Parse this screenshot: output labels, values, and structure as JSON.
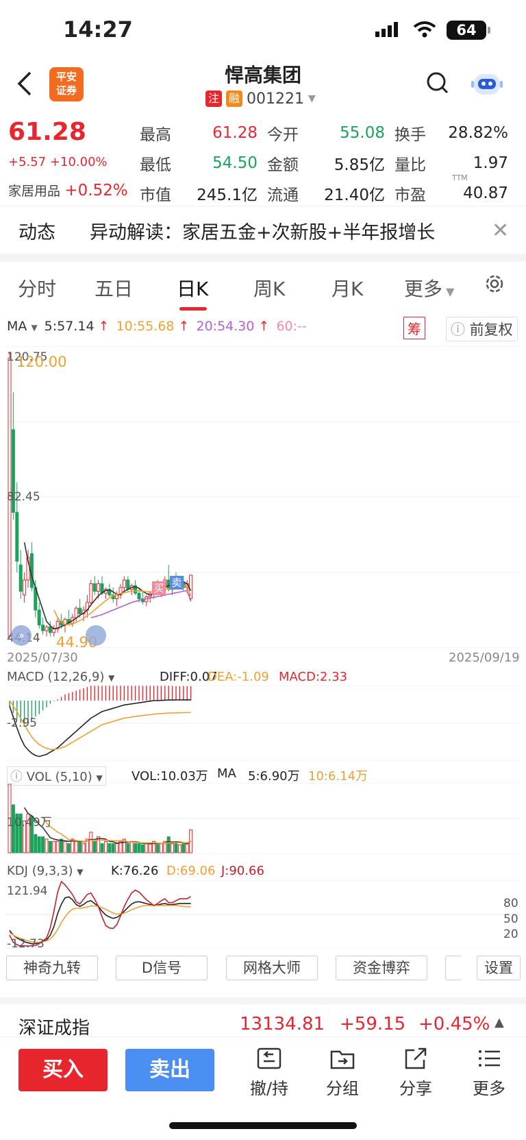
{
  "status": {
    "time": "14:27",
    "battery": "64"
  },
  "header": {
    "title": "悍高集团",
    "tag1": "注",
    "tag2": "融",
    "code": "001221",
    "logo_line1": "平安",
    "logo_line2": "证券"
  },
  "quote": {
    "price": "61.28",
    "change": "+5.57",
    "change_pct": "+10.00%",
    "sector": "家居用品",
    "sector_pct": "+0.52%",
    "rows": [
      [
        {
          "label": "最高",
          "value": "61.28",
          "color": "red"
        },
        {
          "label": "今开",
          "value": "55.08",
          "color": "green"
        },
        {
          "label": "换手",
          "value": "28.82%",
          "color": "black"
        }
      ],
      [
        {
          "label": "最低",
          "value": "54.50",
          "color": "green"
        },
        {
          "label": "金额",
          "value": "5.85亿",
          "color": "black"
        },
        {
          "label": "量比",
          "value": "1.97",
          "color": "black"
        }
      ],
      [
        {
          "label": "市值",
          "value": "245.1亿",
          "color": "black"
        },
        {
          "label": "流通",
          "value": "21.40亿",
          "color": "black"
        },
        {
          "label": "市盈",
          "value": "40.87",
          "color": "black"
        }
      ]
    ],
    "ttm": "TTM"
  },
  "news": {
    "tag": "动态",
    "text": "异动解读：家居五金+次新股+半年报增长"
  },
  "tabs": [
    "分时",
    "五日",
    "日K",
    "周K",
    "月K",
    "更多"
  ],
  "ma": {
    "label": "MA",
    "ma5": "5:57.14",
    "ma10": "10:55.68",
    "ma20": "20:54.30",
    "ma60": "60:--",
    "chip": "筹",
    "adjust": "前复权"
  },
  "kline": {
    "high_label": "120.75",
    "high_mark": "120.00",
    "mid_label": "82.45",
    "low_label": "44.14",
    "low_mark": "44.90",
    "date_start": "2025/07/30",
    "date_end": "2025/09/19",
    "buy_tag": "买",
    "sell_tag": "卖"
  },
  "macd": {
    "label": "MACD (12,26,9)",
    "diff": "DIFF:0.07",
    "dea": "DEA:-1.09",
    "macd": "MACD:2.33",
    "axis": "-2.95"
  },
  "vol": {
    "label": "VOL (5,10)",
    "vol": "VOL:10.03万",
    "ma": "MA",
    "ma5": "5:6.90万",
    "ma10": "10:6.14万",
    "axis": "10.49万"
  },
  "kdj": {
    "label": "KDJ (9,3,3)",
    "k": "K:76.26",
    "d": "D:69.06",
    "j": "J:90.66",
    "top": "121.94",
    "bottom": "-12.73",
    "r80": "80",
    "r50": "50",
    "r20": "20"
  },
  "tools": [
    "神奇九转",
    "D信号",
    "网格大师",
    "资金博弈",
    "设置"
  ],
  "index": {
    "name": "深证成指",
    "value": "13134.81",
    "change": "+59.15",
    "pct": "+0.45%"
  },
  "actions": {
    "buy": "买入",
    "sell": "卖出",
    "cancel": "撤/持",
    "group": "分组",
    "share": "分享",
    "more": "更多"
  },
  "chart_data": {
    "type": "candlestick",
    "date_start": "2025/07/30",
    "date_end": "2025/09/19",
    "ylim": [
      44.14,
      120.75
    ],
    "candles": [
      {
        "o": 45,
        "h": 120.75,
        "l": 44.5,
        "c": 119
      },
      {
        "o": 100,
        "h": 110,
        "l": 76,
        "c": 78
      },
      {
        "o": 78,
        "h": 86,
        "l": 62,
        "c": 65
      },
      {
        "o": 64,
        "h": 68,
        "l": 55,
        "c": 57
      },
      {
        "o": 56,
        "h": 62,
        "l": 54,
        "c": 60
      },
      {
        "o": 60,
        "h": 68,
        "l": 58,
        "c": 66
      },
      {
        "o": 67,
        "h": 70,
        "l": 57,
        "c": 58
      },
      {
        "o": 58,
        "h": 60,
        "l": 50,
        "c": 52
      },
      {
        "o": 52,
        "h": 54,
        "l": 47,
        "c": 48
      },
      {
        "o": 48,
        "h": 50,
        "l": 45.5,
        "c": 46.5
      },
      {
        "o": 46.5,
        "h": 48,
        "l": 45,
        "c": 47.5
      },
      {
        "o": 47.5,
        "h": 49,
        "l": 45,
        "c": 46
      },
      {
        "o": 46,
        "h": 48,
        "l": 44.9,
        "c": 47
      },
      {
        "o": 47,
        "h": 50,
        "l": 46,
        "c": 49
      },
      {
        "o": 49,
        "h": 51,
        "l": 47,
        "c": 48
      },
      {
        "o": 48,
        "h": 50,
        "l": 46,
        "c": 49.5
      },
      {
        "o": 49.5,
        "h": 52,
        "l": 48,
        "c": 48.5
      },
      {
        "o": 48.5,
        "h": 51,
        "l": 47.5,
        "c": 50
      },
      {
        "o": 50,
        "h": 53,
        "l": 49,
        "c": 52.5
      },
      {
        "o": 52.5,
        "h": 55,
        "l": 50,
        "c": 51
      },
      {
        "o": 51,
        "h": 53,
        "l": 49,
        "c": 52
      },
      {
        "o": 52,
        "h": 56,
        "l": 50,
        "c": 54
      },
      {
        "o": 54,
        "h": 60,
        "l": 53,
        "c": 59
      },
      {
        "o": 59,
        "h": 61,
        "l": 56,
        "c": 57
      },
      {
        "o": 57,
        "h": 60,
        "l": 55,
        "c": 59
      },
      {
        "o": 59,
        "h": 61,
        "l": 56,
        "c": 56.5
      },
      {
        "o": 56.5,
        "h": 58,
        "l": 55,
        "c": 57.5
      },
      {
        "o": 57.5,
        "h": 59,
        "l": 55.5,
        "c": 56
      },
      {
        "o": 56,
        "h": 58,
        "l": 54,
        "c": 55
      },
      {
        "o": 55,
        "h": 57,
        "l": 53,
        "c": 56
      },
      {
        "o": 56,
        "h": 59,
        "l": 55,
        "c": 58
      },
      {
        "o": 58,
        "h": 61,
        "l": 57,
        "c": 60
      },
      {
        "o": 60,
        "h": 61,
        "l": 57,
        "c": 57.5
      },
      {
        "o": 57.5,
        "h": 59,
        "l": 56,
        "c": 58.5
      },
      {
        "o": 58.5,
        "h": 60,
        "l": 56,
        "c": 56.5
      },
      {
        "o": 56.5,
        "h": 58,
        "l": 54,
        "c": 55
      },
      {
        "o": 55,
        "h": 57,
        "l": 53.5,
        "c": 54.2
      },
      {
        "o": 54.2,
        "h": 56,
        "l": 53,
        "c": 55.5
      },
      {
        "o": 55.5,
        "h": 57,
        "l": 54,
        "c": 56.5
      },
      {
        "o": 56.5,
        "h": 59,
        "l": 55,
        "c": 58
      },
      {
        "o": 58,
        "h": 60,
        "l": 56,
        "c": 57
      },
      {
        "o": 57,
        "h": 59,
        "l": 55.5,
        "c": 58.5
      },
      {
        "o": 58.5,
        "h": 61,
        "l": 57,
        "c": 60
      },
      {
        "o": 60,
        "h": 64,
        "l": 57,
        "c": 57.5
      },
      {
        "o": 57.5,
        "h": 61,
        "l": 56,
        "c": 60.5
      },
      {
        "o": 60.5,
        "h": 62,
        "l": 58,
        "c": 58.8
      },
      {
        "o": 58.8,
        "h": 61,
        "l": 57.5,
        "c": 59.5
      },
      {
        "o": 59.5,
        "h": 61,
        "l": 57,
        "c": 58
      },
      {
        "o": 58,
        "h": 60,
        "l": 56.5,
        "c": 59
      },
      {
        "o": 55.08,
        "h": 61.28,
        "l": 54.5,
        "c": 61.28
      }
    ],
    "ma5": [
      null,
      null,
      null,
      null,
      70,
      65,
      61,
      58,
      55,
      52,
      49,
      47.8,
      47,
      47.2,
      47.6,
      48,
      48.6,
      49.2,
      49.8,
      50.6,
      51.2,
      52,
      53.4,
      54.6,
      55.8,
      56.6,
      57.2,
      57.4,
      56.8,
      56.2,
      56.2,
      57,
      57.5,
      58,
      58.2,
      57.8,
      57,
      56.4,
      56,
      56.2,
      56.6,
      57.3,
      58,
      58.5,
      58.7,
      59.1,
      59.3,
      59.5,
      59,
      57.14
    ],
    "ma10": [
      null,
      null,
      null,
      null,
      null,
      null,
      null,
      null,
      null,
      null,
      null,
      null,
      52,
      50,
      48.8,
      48.2,
      48,
      48.3,
      48.7,
      49.2,
      49.8,
      50.5,
      51.2,
      52,
      52.9,
      53.7,
      54.5,
      55.2,
      55.8,
      56.2,
      56.4,
      56.6,
      56.8,
      57,
      57.1,
      57.1,
      57,
      56.9,
      56.9,
      57,
      57.1,
      57.3,
      57.5,
      57.7,
      57.8,
      58,
      58.2,
      58.4,
      58.5,
      55.68
    ],
    "ma20": [
      null,
      null,
      null,
      null,
      null,
      null,
      null,
      null,
      null,
      null,
      null,
      null,
      null,
      null,
      null,
      null,
      null,
      null,
      null,
      null,
      null,
      null,
      50,
      50.2,
      50.5,
      50.8,
      51.2,
      51.6,
      52,
      52.4,
      52.8,
      53.2,
      53.6,
      54,
      54.3,
      54.6,
      54.8,
      55,
      55.2,
      55.4,
      55.6,
      55.8,
      56,
      56.2,
      56.4,
      56.6,
      56.8,
      57,
      57.2,
      54.3
    ],
    "volume": [
      30,
      21,
      17,
      17,
      14,
      17,
      16,
      8,
      7,
      7,
      6,
      5,
      5,
      5,
      6,
      5,
      4,
      6,
      5,
      5,
      4,
      6,
      9,
      5,
      7,
      4,
      5,
      4,
      4,
      4,
      5,
      6,
      4,
      5,
      4,
      4,
      3.5,
      4,
      4,
      5,
      3.5,
      4,
      5,
      7,
      4,
      4,
      3.5,
      4,
      4,
      10.03
    ],
    "macd_diff": [
      -0.5,
      -1.5,
      -2.5,
      -3.4,
      -4.1,
      -4.5,
      -4.8,
      -5.0,
      -5.1,
      -5.0,
      -4.9,
      -4.7,
      -4.5,
      -4.3,
      -4.0,
      -3.7,
      -3.4,
      -3.1,
      -2.8,
      -2.5,
      -2.2,
      -1.9,
      -1.6,
      -1.4,
      -1.2,
      -1.0,
      -0.9,
      -0.8,
      -0.7,
      -0.6,
      -0.5,
      -0.4,
      -0.35,
      -0.3,
      -0.25,
      -0.2,
      -0.15,
      -0.1,
      -0.05,
      0.0,
      0.0,
      0.02,
      0.04,
      0.05,
      0.05,
      0.06,
      0.06,
      0.07,
      0.07,
      0.07
    ],
    "macd_dea": [
      0,
      -0.5,
      -1.0,
      -1.6,
      -2.2,
      -2.8,
      -3.3,
      -3.7,
      -4.0,
      -4.2,
      -4.35,
      -4.45,
      -4.45,
      -4.4,
      -4.3,
      -4.2,
      -4.0,
      -3.8,
      -3.6,
      -3.4,
      -3.2,
      -3.0,
      -2.8,
      -2.6,
      -2.4,
      -2.2,
      -2.1,
      -2.0,
      -1.9,
      -1.8,
      -1.7,
      -1.6,
      -1.55,
      -1.5,
      -1.45,
      -1.4,
      -1.36,
      -1.32,
      -1.28,
      -1.24,
      -1.2,
      -1.18,
      -1.16,
      -1.14,
      -1.13,
      -1.12,
      -1.11,
      -1.1,
      -1.095,
      -1.09
    ],
    "macd_hist": [
      -1,
      -2,
      -3,
      -3.6,
      -3.8,
      -3.4,
      -3,
      -2.6,
      -2.2,
      -1.6,
      -1.1,
      -0.5,
      -0.1,
      0.2,
      0.6,
      1,
      1.2,
      1.4,
      1.6,
      1.8,
      2,
      2.2,
      2.4,
      2.4,
      2.4,
      2.4,
      2.4,
      2.4,
      2.4,
      2.4,
      2.4,
      2.4,
      2.4,
      2.4,
      2.4,
      2.4,
      2.4,
      2.4,
      2.4,
      2.4,
      2.4,
      2.4,
      2.4,
      2.4,
      2.36,
      2.36,
      2.34,
      2.34,
      2.33,
      2.33
    ],
    "kdj_k": [
      20,
      10,
      4,
      0,
      -4,
      -6,
      -8,
      -8,
      -6,
      -3,
      0,
      10,
      28,
      55,
      75,
      88,
      90,
      84,
      74,
      70,
      74,
      80,
      82,
      76,
      70,
      60,
      52,
      48,
      45,
      47,
      52,
      60,
      68,
      75,
      79,
      80,
      78,
      76,
      74,
      72,
      73,
      75,
      76,
      74,
      74,
      75,
      76,
      76,
      76,
      76.26
    ],
    "kdj_d": [
      15,
      10,
      6,
      3,
      0,
      -2,
      -4,
      -5,
      -5,
      -4,
      -2,
      2,
      10,
      22,
      36,
      48,
      58,
      64,
      66,
      66,
      67,
      69,
      71,
      71,
      70,
      67,
      64,
      60,
      56,
      54,
      54,
      56,
      59,
      63,
      66,
      69,
      71,
      72,
      72,
      72,
      72,
      72,
      72,
      72,
      72,
      72,
      71,
      70,
      69.5,
      69.06
    ],
    "kdj_j": [
      10,
      -5,
      -10,
      -12.73,
      -12,
      -13,
      -12,
      -12,
      -8,
      -2,
      4,
      25,
      60,
      100,
      121.94,
      115,
      105,
      95,
      80,
      75,
      85,
      95,
      98,
      85,
      70,
      48,
      30,
      25,
      24,
      32,
      50,
      70,
      85,
      98,
      104,
      100,
      92,
      84,
      78,
      72,
      76,
      82,
      86,
      78,
      78,
      82,
      86,
      86,
      86,
      90.66
    ]
  }
}
